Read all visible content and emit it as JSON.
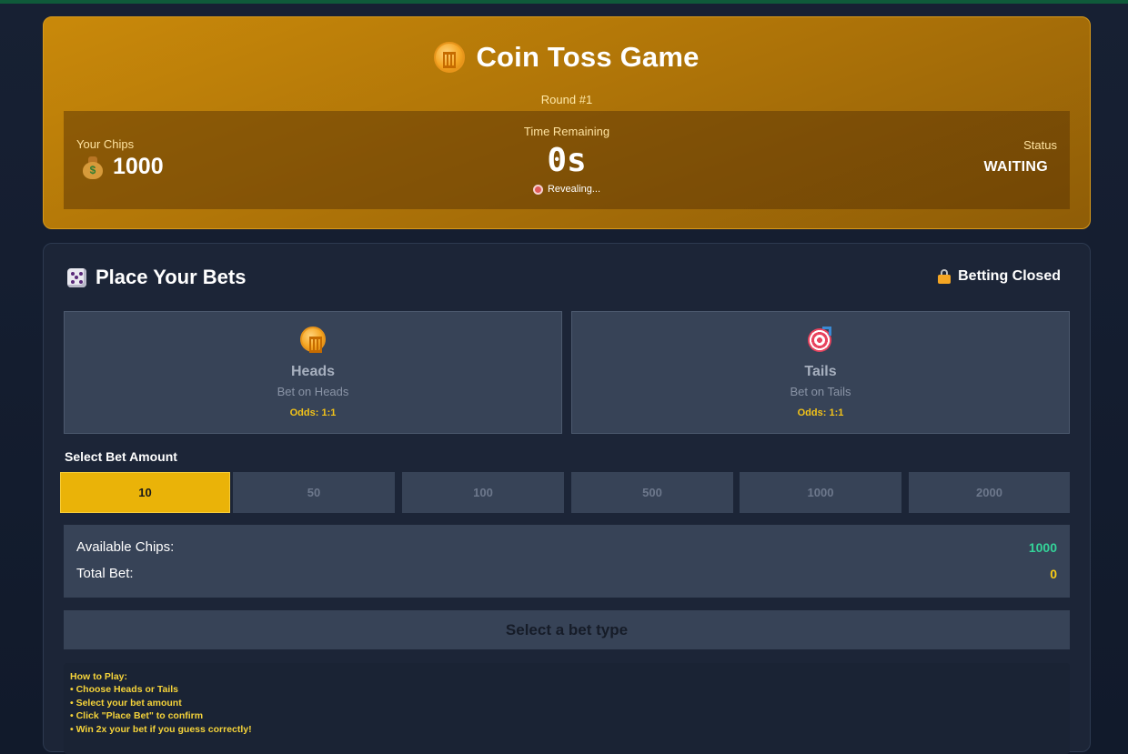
{
  "header": {
    "title": "Coin Toss Game",
    "round": "Round #1",
    "chips_label": "Your Chips",
    "chips_value": "1000",
    "time_label": "Time Remaining",
    "time_value": "0s",
    "revealing": "Revealing...",
    "status_label": "Status",
    "status_value": "WAITING"
  },
  "bets": {
    "title": "Place Your Bets",
    "closed_label": "Betting Closed",
    "options": [
      {
        "name": "Heads",
        "sub": "Bet on Heads",
        "odds": "Odds: 1:1"
      },
      {
        "name": "Tails",
        "sub": "Bet on Tails",
        "odds": "Odds: 1:1"
      }
    ],
    "amount_label": "Select Bet Amount",
    "amounts": [
      "10",
      "50",
      "100",
      "500",
      "1000",
      "2000"
    ],
    "selected_amount": "10",
    "available_label": "Available Chips:",
    "available_value": "1000",
    "total_label": "Total Bet:",
    "total_value": "0",
    "action_button": "Select a bet type"
  },
  "howto": {
    "title": "How to Play:",
    "steps": [
      "• Choose Heads or Tails",
      "• Select your bet amount",
      "• Click \"Place Bet\" to confirm",
      "• Win 2x your bet if you guess correctly!"
    ]
  },
  "colors": {
    "accent": "#eab308",
    "header_gold": "#c9890a",
    "available_green": "#34d399",
    "total_yellow": "#facc15",
    "howto_text": "#f6d43a"
  },
  "icons": {
    "title": "coin-icon",
    "chips": "money-bag-icon",
    "revealing": "alarm-clock-icon",
    "bets_title": "dice-icon",
    "closed": "lock-icon",
    "heads": "coin-icon",
    "tails": "target-icon"
  }
}
